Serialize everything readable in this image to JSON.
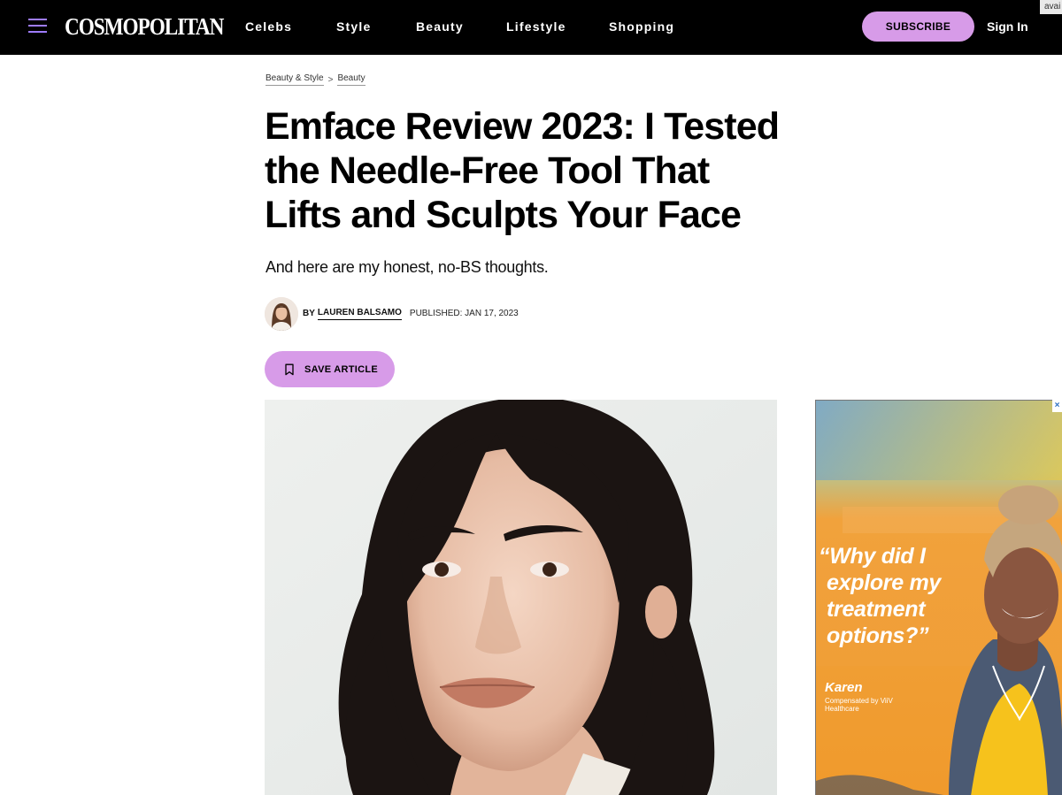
{
  "header": {
    "logo": "COSMOPOLITAN",
    "nav": [
      "Celebs",
      "Style",
      "Beauty",
      "Lifestyle",
      "Shopping"
    ],
    "subscribe_label": "SUBSCRIBE",
    "signin_label": "Sign In",
    "corner_tab": "avai"
  },
  "breadcrumb": {
    "items": [
      "Beauty & Style",
      "Beauty"
    ],
    "separator": ">"
  },
  "article": {
    "title_lines": [
      "Emface Review 2023: I Tested",
      "the Needle-Free Tool That",
      "Lifts and Sculpts Your Face"
    ],
    "dek": "And here are my honest, no-BS thoughts.",
    "byline_prefix": "BY",
    "author": "LAUREN BALSAMO",
    "published": "PUBLISHED: JAN 17, 2023",
    "save_label": "SAVE ARTICLE"
  },
  "ad": {
    "close": "×",
    "quote_lines": [
      "“Why did I",
      "explore my",
      "treatment",
      "options?”"
    ],
    "name": "Karen",
    "compensation": "Compensated by ViiV Healthcare"
  },
  "colors": {
    "header_bg": "#000000",
    "accent_pink": "#d79be8",
    "menu_purple": "#9e7cff",
    "ad_orange": "#f0982e"
  }
}
